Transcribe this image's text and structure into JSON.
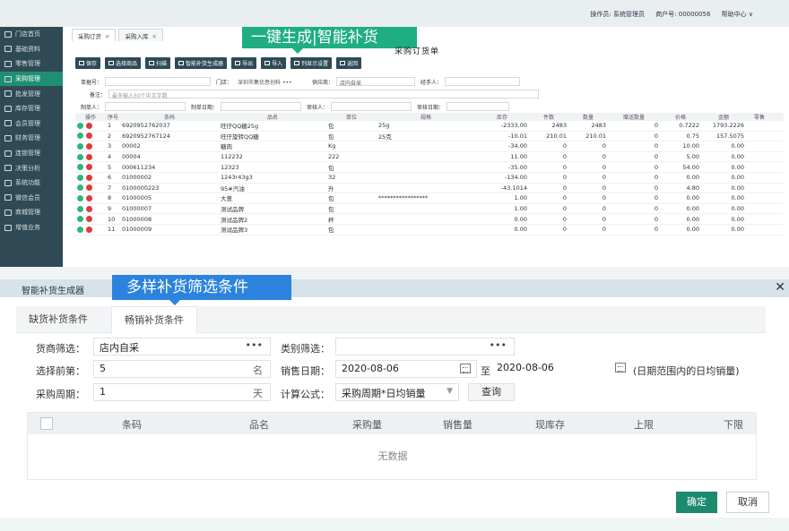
{
  "header": {
    "operator": "操作员: 系统管理员",
    "merchant": "商户号: 00000056",
    "help": "帮助中心 ∨"
  },
  "sidebar": {
    "items": [
      {
        "label": "门店首页",
        "icon": "home-icon"
      },
      {
        "label": "基础资料",
        "icon": "list-icon"
      },
      {
        "label": "零售管理",
        "icon": "register-icon"
      },
      {
        "label": "采购管理",
        "icon": "cart-icon"
      },
      {
        "label": "批发管理",
        "icon": "truck-icon"
      },
      {
        "label": "库存管理",
        "icon": "box-icon"
      },
      {
        "label": "会员管理",
        "icon": "user-icon"
      },
      {
        "label": "财务管理",
        "icon": "money-icon"
      },
      {
        "label": "连锁管理",
        "icon": "chain-icon"
      },
      {
        "label": "决策分析",
        "icon": "chart-icon"
      },
      {
        "label": "系统功能",
        "icon": "gear-icon"
      },
      {
        "label": "微信会员",
        "icon": "wechat-icon"
      },
      {
        "label": "商城管理",
        "icon": "shop-icon"
      },
      {
        "label": "增值业务",
        "icon": "heart-icon"
      }
    ],
    "active_index": 3
  },
  "tabs": [
    {
      "label": "采购订货"
    },
    {
      "label": "采购入库"
    }
  ],
  "callout_top": "一键生成|智能补货",
  "form_title": "采购订货单",
  "toolbar": [
    "保存",
    "选择商品",
    "扫描",
    "智能补货生成器",
    "导出",
    "导入",
    "列显示设置",
    "返回"
  ],
  "form": {
    "doc_no_label": "单据号：",
    "store_label": "门店：",
    "store_value": "深圳市集优思创科 •••",
    "supplier_label": "供应商：",
    "supplier_value": "店内自采",
    "handler_label": "经手人：",
    "note_label": "备注：",
    "note_placeholder": "最多输入50个中文字数",
    "maker_label": "制单人：",
    "make_date_label": "制单日期：",
    "checker_label": "审核人：",
    "check_date_label": "审核日期："
  },
  "grid": {
    "headers": [
      "操作",
      "序号",
      "条码",
      "品名",
      "单位",
      "规格",
      "库存",
      "件数",
      "数量",
      "赠送数量",
      "价格",
      "金额",
      "零售"
    ],
    "rows": [
      [
        "1",
        "6920952762037",
        "旺仔QQ糖25g",
        "包",
        "25g",
        "-2333.00",
        "2483",
        "2483",
        "0",
        "0.7222",
        "1793.2226"
      ],
      [
        "2",
        "6920952767124",
        "旺仔旋转QQ糖",
        "包",
        "25克",
        "-10.01",
        "210.01",
        "210.01",
        "0",
        "0.75",
        "157.5075"
      ],
      [
        "3",
        "00002",
        "糖肉",
        "Kg",
        "",
        "-34.00",
        "0",
        "0",
        "0",
        "10.00",
        "0.00"
      ],
      [
        "4",
        "00004",
        "112232",
        "222",
        "",
        "11.00",
        "0",
        "0",
        "0",
        "5.00",
        "0.00"
      ],
      [
        "5",
        "000611234",
        "12323",
        "包",
        "",
        "-35.00",
        "0",
        "0",
        "0",
        "54.00",
        "0.00"
      ],
      [
        "6",
        "01000002",
        "1243r43g3",
        "32",
        "",
        "-134.00",
        "0",
        "0",
        "0",
        "0.00",
        "0.00"
      ],
      [
        "7",
        "0100000223",
        "95#汽油",
        "升",
        "",
        "-43.1014",
        "0",
        "0",
        "0",
        "4.80",
        "0.00"
      ],
      [
        "8",
        "01000005",
        "大葱",
        "包",
        "*****************",
        "1.00",
        "0",
        "0",
        "0",
        "0.00",
        "0.00"
      ],
      [
        "9",
        "01000007",
        "测试品牌",
        "包",
        "",
        "1.00",
        "0",
        "0",
        "0",
        "0.00",
        "0.00"
      ],
      [
        "10",
        "01000008",
        "测试品牌2",
        "杯",
        "",
        "0.00",
        "0",
        "0",
        "0",
        "0.00",
        "0.00"
      ],
      [
        "11",
        "01000009",
        "测试品牌3",
        "包",
        "",
        "0.00",
        "0",
        "0",
        "0",
        "0.00",
        "0.00"
      ]
    ]
  },
  "dialog": {
    "title": "智能补货生成器",
    "callout": "多样补货筛选条件",
    "close": "✕",
    "tabs": [
      "缺货补货条件",
      "畅销补货条件"
    ],
    "active_tab": 1,
    "supplier_label": "货商筛选：",
    "supplier_value": "店内自采",
    "category_label": "类别筛选：",
    "top_label": "选择前第：",
    "top_value": "5",
    "top_unit": "名",
    "sales_date_label": "销售日期：",
    "date_from": "2020-08-06",
    "to": "至",
    "date_to": "2020-08-06",
    "date_hint": "(日期范围内的日均销量)",
    "cycle_label": "采购周期：",
    "cycle_value": "1",
    "cycle_unit": "天",
    "formula_label": "计算公式：",
    "formula_value": "采购周期*日均销量",
    "query": "查询",
    "dots": "•••",
    "table_headers": [
      "条码",
      "品名",
      "采购量",
      "销售量",
      "现库存",
      "上限",
      "下限"
    ],
    "empty": "无数据",
    "ok": "确定",
    "cancel": "取消"
  }
}
